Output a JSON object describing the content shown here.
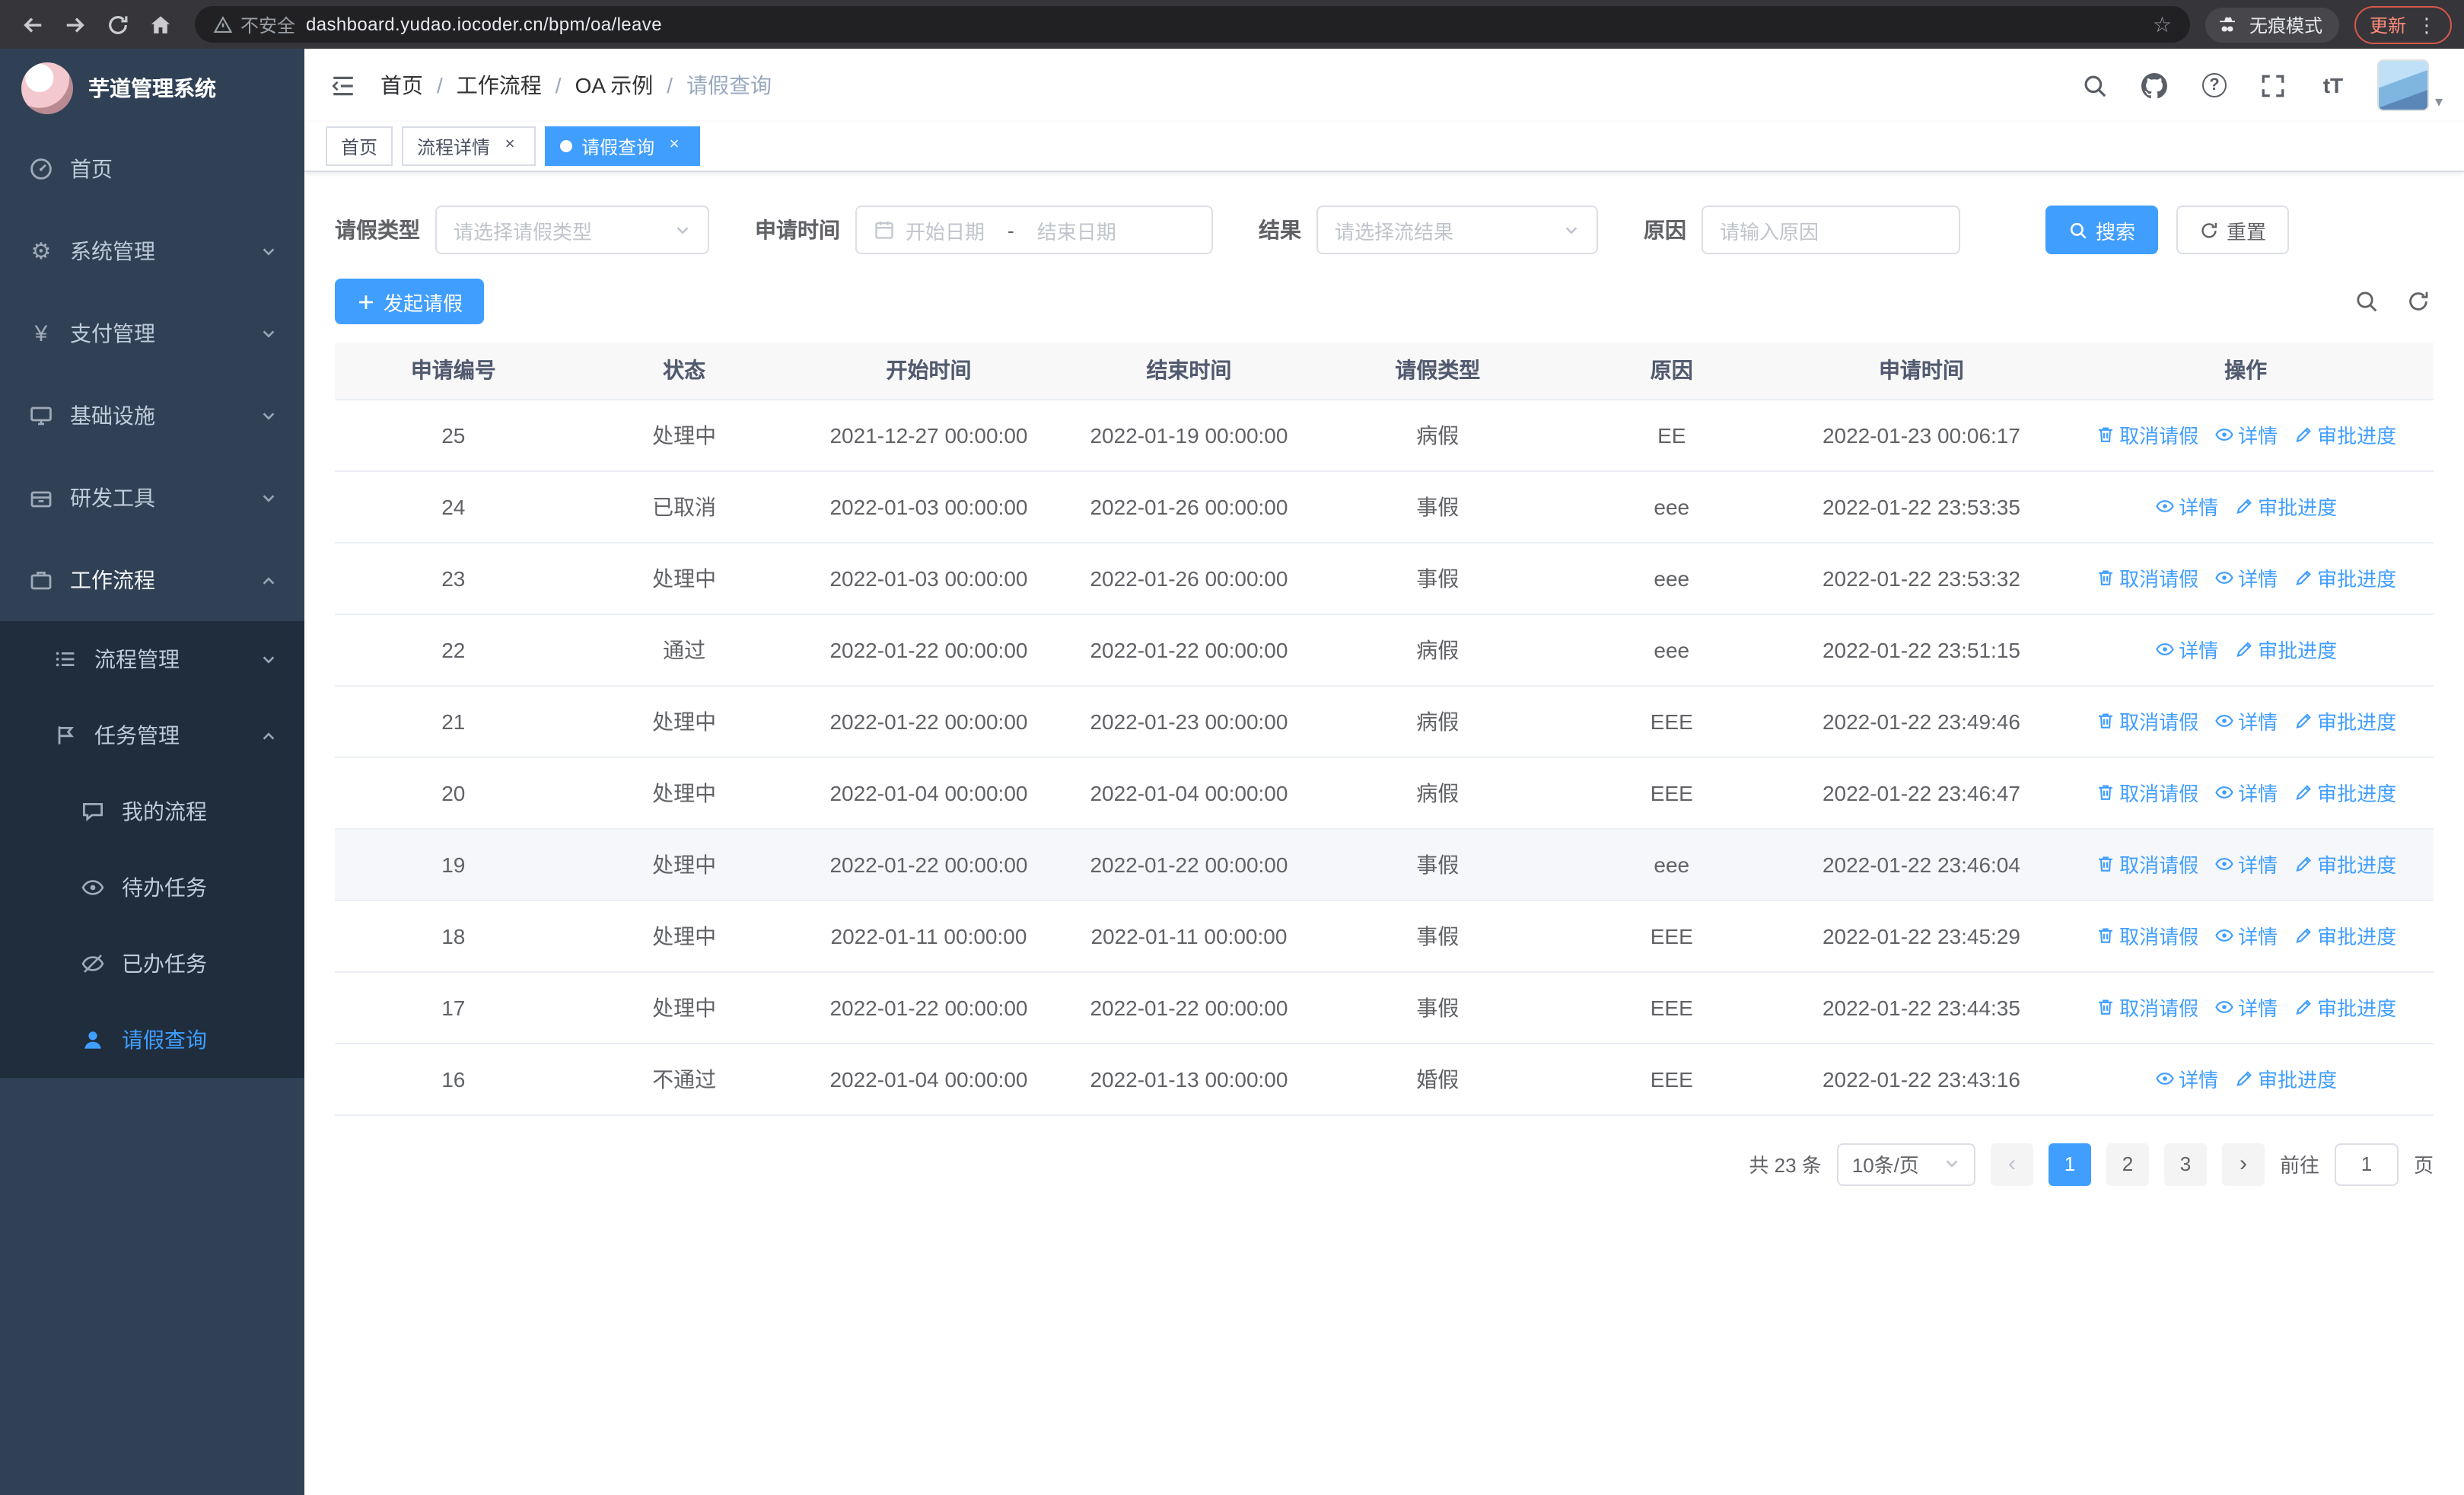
{
  "browser": {
    "security_label": "不安全",
    "url": "dashboard.yudao.iocoder.cn/bpm/oa/leave",
    "incognito_label": "无痕模式",
    "update_label": "更新"
  },
  "sidebar": {
    "logo_title": "芋道管理系统",
    "items": [
      {
        "label": "首页",
        "icon": "home-icon"
      },
      {
        "label": "系统管理",
        "icon": "gear-icon"
      },
      {
        "label": "支付管理",
        "icon": "yen-icon"
      },
      {
        "label": "基础设施",
        "icon": "monitor-icon"
      },
      {
        "label": "研发工具",
        "icon": "toolbox-icon"
      },
      {
        "label": "工作流程",
        "icon": "briefcase-icon"
      },
      {
        "label": "流程管理",
        "icon": "list-icon"
      },
      {
        "label": "任务管理",
        "icon": "flag-icon"
      },
      {
        "label": "我的流程",
        "icon": "chat-icon"
      },
      {
        "label": "待办任务",
        "icon": "eye-icon"
      },
      {
        "label": "已办任务",
        "icon": "eye-off-icon"
      },
      {
        "label": "请假查询",
        "icon": "user-icon"
      }
    ]
  },
  "header": {
    "breadcrumb": [
      "首页",
      "工作流程",
      "OA 示例",
      "请假查询"
    ]
  },
  "tabs": [
    {
      "label": "首页"
    },
    {
      "label": "流程详情"
    },
    {
      "label": "请假查询"
    }
  ],
  "filters": {
    "leave_type_label": "请假类型",
    "leave_type_placeholder": "请选择请假类型",
    "apply_time_label": "申请时间",
    "start_date_placeholder": "开始日期",
    "range_separator": "-",
    "end_date_placeholder": "结束日期",
    "result_label": "结果",
    "result_placeholder": "请选择流结果",
    "reason_label": "原因",
    "reason_placeholder": "请输入原因",
    "search_button": "搜索",
    "reset_button": "重置"
  },
  "toolbar": {
    "create_button": "发起请假"
  },
  "table": {
    "columns": [
      "申请编号",
      "状态",
      "开始时间",
      "结束时间",
      "请假类型",
      "原因",
      "申请时间",
      "操作"
    ],
    "action_labels": {
      "cancel": "取消请假",
      "detail": "详情",
      "progress": "审批进度"
    },
    "action_icons": {
      "cancel": "trash-icon",
      "detail": "eye-icon",
      "progress": "edit-icon"
    },
    "rows": [
      {
        "id": "25",
        "status": "处理中",
        "start": "2021-12-27 00:00:00",
        "end": "2022-01-19 00:00:00",
        "type": "病假",
        "reason": "EE",
        "applied": "2022-01-23 00:06:17",
        "actions": [
          "cancel",
          "detail",
          "progress"
        ],
        "highlight": false
      },
      {
        "id": "24",
        "status": "已取消",
        "start": "2022-01-03 00:00:00",
        "end": "2022-01-26 00:00:00",
        "type": "事假",
        "reason": "eee",
        "applied": "2022-01-22 23:53:35",
        "actions": [
          "detail",
          "progress"
        ],
        "highlight": false
      },
      {
        "id": "23",
        "status": "处理中",
        "start": "2022-01-03 00:00:00",
        "end": "2022-01-26 00:00:00",
        "type": "事假",
        "reason": "eee",
        "applied": "2022-01-22 23:53:32",
        "actions": [
          "cancel",
          "detail",
          "progress"
        ],
        "highlight": false
      },
      {
        "id": "22",
        "status": "通过",
        "start": "2022-01-22 00:00:00",
        "end": "2022-01-22 00:00:00",
        "type": "病假",
        "reason": "eee",
        "applied": "2022-01-22 23:51:15",
        "actions": [
          "detail",
          "progress"
        ],
        "highlight": false
      },
      {
        "id": "21",
        "status": "处理中",
        "start": "2022-01-22 00:00:00",
        "end": "2022-01-23 00:00:00",
        "type": "病假",
        "reason": "EEE",
        "applied": "2022-01-22 23:49:46",
        "actions": [
          "cancel",
          "detail",
          "progress"
        ],
        "highlight": false
      },
      {
        "id": "20",
        "status": "处理中",
        "start": "2022-01-04 00:00:00",
        "end": "2022-01-04 00:00:00",
        "type": "病假",
        "reason": "EEE",
        "applied": "2022-01-22 23:46:47",
        "actions": [
          "cancel",
          "detail",
          "progress"
        ],
        "highlight": false
      },
      {
        "id": "19",
        "status": "处理中",
        "start": "2022-01-22 00:00:00",
        "end": "2022-01-22 00:00:00",
        "type": "事假",
        "reason": "eee",
        "applied": "2022-01-22 23:46:04",
        "actions": [
          "cancel",
          "detail",
          "progress"
        ],
        "highlight": true
      },
      {
        "id": "18",
        "status": "处理中",
        "start": "2022-01-11 00:00:00",
        "end": "2022-01-11 00:00:00",
        "type": "事假",
        "reason": "EEE",
        "applied": "2022-01-22 23:45:29",
        "actions": [
          "cancel",
          "detail",
          "progress"
        ],
        "highlight": false
      },
      {
        "id": "17",
        "status": "处理中",
        "start": "2022-01-22 00:00:00",
        "end": "2022-01-22 00:00:00",
        "type": "事假",
        "reason": "EEE",
        "applied": "2022-01-22 23:44:35",
        "actions": [
          "cancel",
          "detail",
          "progress"
        ],
        "highlight": false
      },
      {
        "id": "16",
        "status": "不通过",
        "start": "2022-01-04 00:00:00",
        "end": "2022-01-13 00:00:00",
        "type": "婚假",
        "reason": "EEE",
        "applied": "2022-01-22 23:43:16",
        "actions": [
          "detail",
          "progress"
        ],
        "highlight": false
      }
    ]
  },
  "pagination": {
    "total_text": "共 23 条",
    "page_size": "10条/页",
    "pages": [
      "1",
      "2",
      "3"
    ],
    "active_page": "1",
    "goto_label": "前往",
    "goto_value": "1",
    "goto_suffix": "页"
  },
  "colors": {
    "accent": "#409eff",
    "sidebar_bg": "#304156",
    "submenu_bg": "#1f2d3d"
  }
}
